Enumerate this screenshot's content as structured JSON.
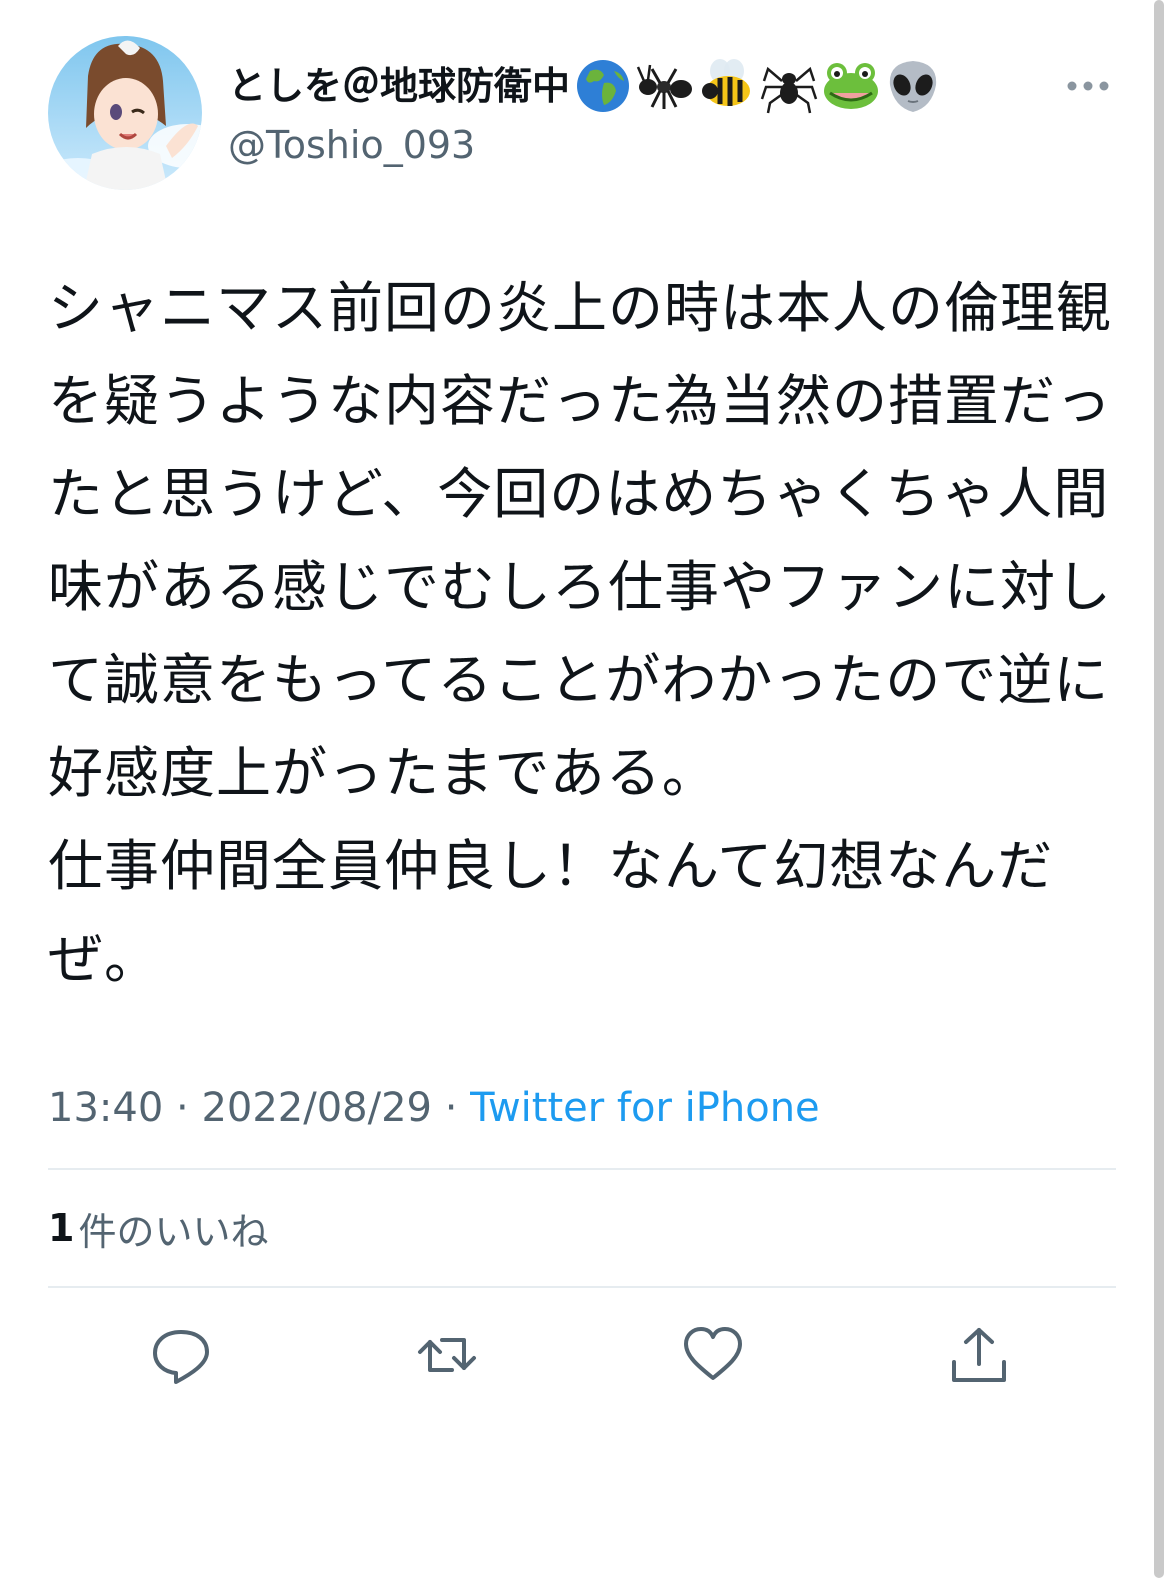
{
  "user": {
    "display_name": "としを＠地球防衛中",
    "name_emojis": [
      "globe-emoji",
      "ant-emoji",
      "bee-emoji",
      "spider-emoji",
      "frog-emoji",
      "alien-emoji"
    ],
    "handle": "@Toshio_093"
  },
  "tweet": {
    "text": "シャニマス前回の炎上の時は本人の倫理観を疑うような内容だった為当然の措置だったと思うけど、今回のはめちゃくちゃ人間味がある感じでむしろ仕事やファンに対して誠意をもってることがわかったので逆に好感度上がったまである。\n仕事仲間全員仲良し！なんて幻想なんだぜ。",
    "time": "13:40",
    "date": "2022/08/29",
    "separator": "·",
    "source": "Twitter for iPhone"
  },
  "engagement": {
    "likes_count": "1",
    "likes_label": "件のいいね"
  },
  "actions": [
    "reply-icon",
    "retweet-icon",
    "like-icon",
    "share-icon"
  ],
  "colors": {
    "link": "#1d9bf0",
    "secondary_text": "#536471",
    "divider": "#e6ecf0"
  }
}
